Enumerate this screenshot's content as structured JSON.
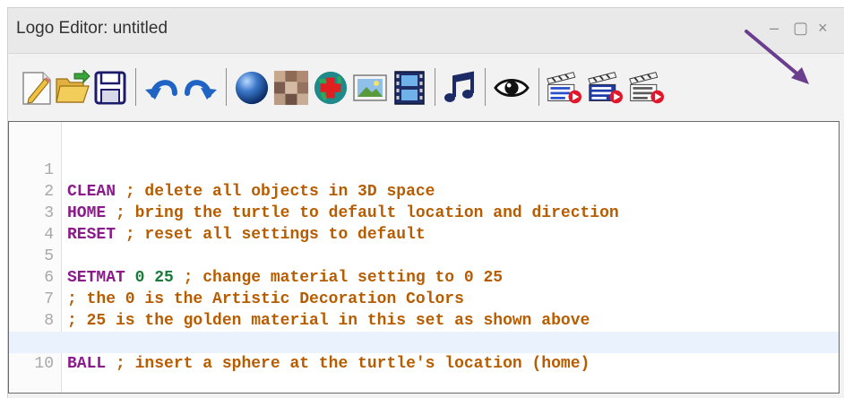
{
  "window": {
    "title": "Logo Editor: untitled",
    "minimize_glyph": "–",
    "maximize_glyph": "▢",
    "close_glyph": "×"
  },
  "toolbar": {
    "buttons": [
      {
        "name": "new-file-icon"
      },
      {
        "name": "open-folder-icon"
      },
      {
        "name": "save-icon"
      },
      {
        "name": "undo-icon"
      },
      {
        "name": "redo-icon"
      },
      {
        "name": "sphere-icon"
      },
      {
        "name": "texture-icon"
      },
      {
        "name": "globe-add-icon"
      },
      {
        "name": "image-icon"
      },
      {
        "name": "film-icon"
      },
      {
        "name": "music-note-icon"
      },
      {
        "name": "eye-icon"
      },
      {
        "name": "run-clapper-red-icon"
      },
      {
        "name": "run-clapper-blue-icon"
      },
      {
        "name": "run-clapper-gray-icon"
      }
    ]
  },
  "editor": {
    "lines": [
      {
        "n": "1",
        "kw": "CLEAN",
        "args": "",
        "comment": " ; delete all objects in 3D space"
      },
      {
        "n": "2",
        "kw": "HOME",
        "args": "",
        "comment": " ; bring the turtle to default location and direction"
      },
      {
        "n": "3",
        "kw": "RESET",
        "args": "",
        "comment": " ; reset all settings to default"
      },
      {
        "n": "4",
        "kw": "",
        "args": "",
        "comment": ""
      },
      {
        "n": "5",
        "kw": "SETMAT",
        "args": " 0 25",
        "comment": " ; change material setting to 0 25"
      },
      {
        "n": "6",
        "kw": "",
        "args": "",
        "comment": "; the 0 is the Artistic Decoration Colors"
      },
      {
        "n": "7",
        "kw": "",
        "args": "",
        "comment": "; 25 is the golden material in this set as shown above"
      },
      {
        "n": "8",
        "kw": "",
        "args": "",
        "comment": ""
      },
      {
        "n": "9",
        "kw": "BALL",
        "args": "",
        "comment": " ; insert a sphere at the turtle's location (home)"
      },
      {
        "n": "10",
        "kw": "",
        "args": "",
        "comment": ""
      }
    ],
    "active_line": 10
  },
  "colors": {
    "keyword": "#8b1a8b",
    "number": "#1a7a3c",
    "comment": "#b85c00",
    "annotation_arrow": "#6a3d8f"
  }
}
